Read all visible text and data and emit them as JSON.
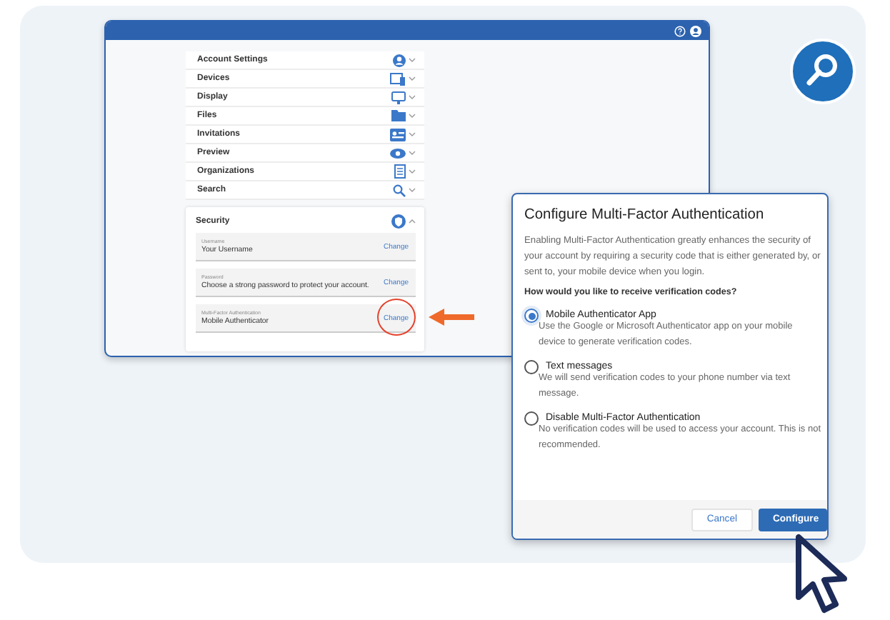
{
  "settings": {
    "sections": [
      {
        "label": "Account Settings",
        "kind": "account",
        "expanded": false
      },
      {
        "label": "Devices",
        "kind": "devices",
        "expanded": false
      },
      {
        "label": "Display",
        "kind": "display",
        "expanded": false
      },
      {
        "label": "Files",
        "kind": "files",
        "expanded": false
      },
      {
        "label": "Invitations",
        "kind": "invitations",
        "expanded": false
      },
      {
        "label": "Preview",
        "kind": "preview",
        "expanded": false
      },
      {
        "label": "Organizations",
        "kind": "organizations",
        "expanded": false
      },
      {
        "label": "Search",
        "kind": "search",
        "expanded": false
      }
    ],
    "security": {
      "label": "Security",
      "expanded": true,
      "fields": [
        {
          "label": "Username",
          "value": "Your Username",
          "action": "Change",
          "annotated": false
        },
        {
          "label": "Password",
          "value": "Choose a strong password to protect your account.",
          "action": "Change",
          "annotated": false
        },
        {
          "label": "Multi-Factor Authentication",
          "value": "Mobile Authenticator",
          "action": "Change",
          "annotated": true
        }
      ]
    }
  },
  "dialog": {
    "title": "Configure Multi-Factor Authentication",
    "intro": "Enabling Multi-Factor Authentication greatly enhances the security of your account by requiring a security code that is either generated by, or sent to, your mobile device when you login.",
    "question": "How would you like to receive verification codes?",
    "options": [
      {
        "label": "Mobile Authenticator App",
        "description": "Use the Google or Microsoft Authenticator app on your mobile device to generate verification codes.",
        "selected": true
      },
      {
        "label": "Text messages",
        "description": "We will send verification codes to your phone number via text message.",
        "selected": false
      },
      {
        "label": "Disable Multi-Factor Authentication",
        "description": "No verification codes will be used to access your account. This is not recommended.",
        "selected": false
      }
    ],
    "buttons": [
      {
        "label": "Cancel",
        "kind": "secondary"
      },
      {
        "label": "Configure",
        "kind": "primary"
      }
    ]
  }
}
